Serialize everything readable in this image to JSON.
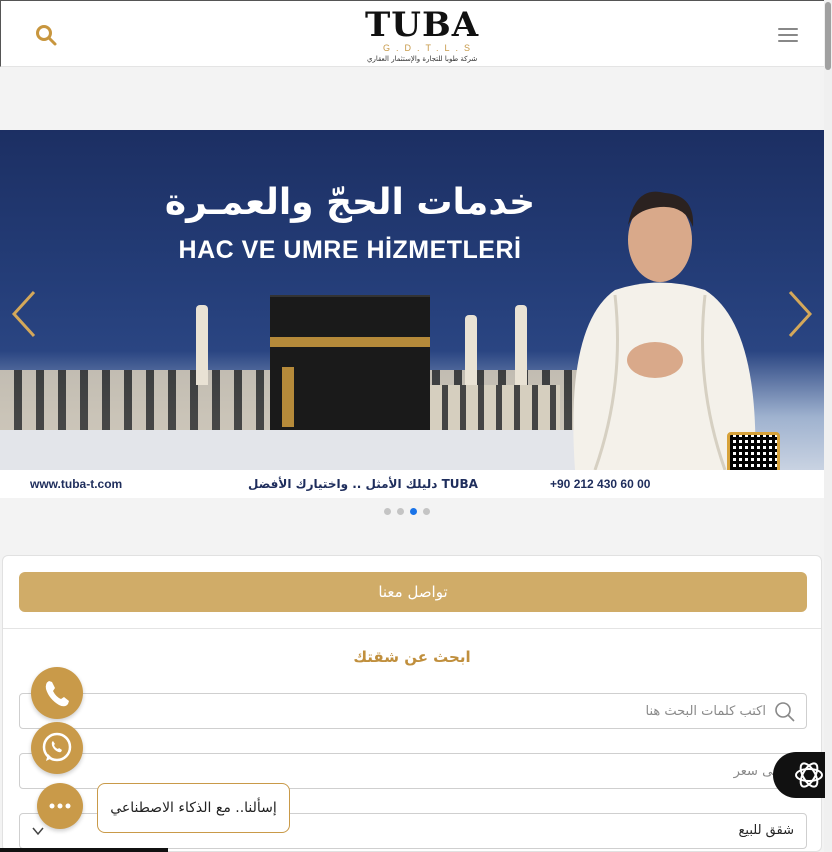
{
  "header": {
    "logo_text": "TUBA",
    "logo_sub": "G.D.T.L.S",
    "logo_tagline": "شركة طوبا للتجارة والإستثمار العقاري",
    "search_icon": "search-icon",
    "menu_icon": "hamburger-menu-icon"
  },
  "slider": {
    "title_ar": "خدمات الحجّ والعمـرة",
    "title_tr": "HAC VE UMRE HİZMETLERİ",
    "website": "www.tuba-t.com",
    "slogan": "TUBA دليلك الأمثل .. واختيارك الأفضل",
    "phone": "+90 212 430 60 00",
    "dots_total": 4,
    "active_dot": 3,
    "colors": {
      "arrow": "#d4a85a",
      "active_dot": "#1a73e8"
    }
  },
  "panel": {
    "contact_button": "تواصل معنا",
    "section_title": "ابحث عن شقتك",
    "search_placeholder": "اكتب كلمات البحث هنا",
    "max_price_placeholder": "أقصى سعر",
    "type_select_value": "شقق للبيع"
  },
  "floating": {
    "ai_chat_label": "إسألنا.. مع الذكاء الاصطناعي",
    "phone_icon": "phone-icon",
    "whatsapp_icon": "whatsapp-icon",
    "chat_icon": "chat-dots-icon",
    "accent": "#c99a49"
  }
}
